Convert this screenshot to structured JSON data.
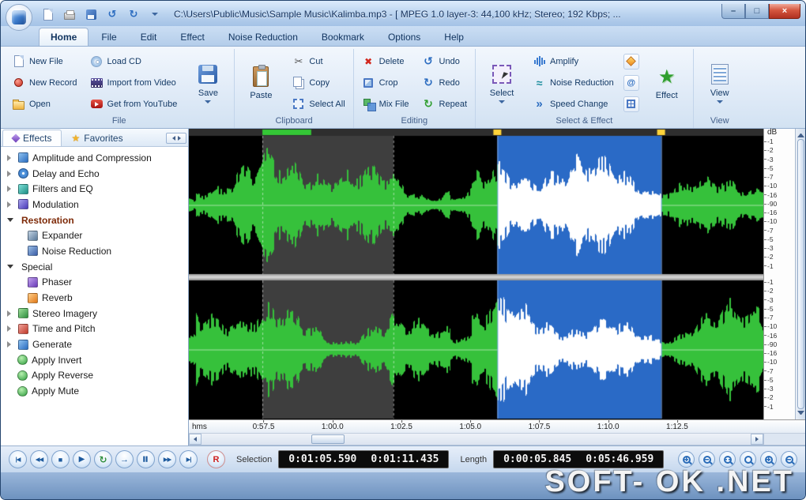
{
  "window": {
    "title": "C:\\Users\\Public\\Music\\Sample Music\\Kalimba.mp3 - [ MPEG 1.0 layer-3: 44,100 kHz; Stereo; 192 Kbps; ...",
    "controls": {
      "minimize": "–",
      "maximize": "□",
      "close": "×"
    }
  },
  "tabs": {
    "items": [
      "Home",
      "File",
      "Edit",
      "Effect",
      "Noise Reduction",
      "Bookmark",
      "Options",
      "Help"
    ],
    "active": "Home"
  },
  "ribbon": {
    "file": {
      "label": "File",
      "new_file": "New File",
      "new_record": "New Record",
      "open": "Open",
      "load_cd": "Load CD",
      "import_video": "Import from Video",
      "get_youtube": "Get from YouTube",
      "save": "Save"
    },
    "clipboard": {
      "label": "Clipboard",
      "paste": "Paste",
      "cut": "Cut",
      "copy": "Copy",
      "select_all": "Select All"
    },
    "editing": {
      "label": "Editing",
      "delete": "Delete",
      "crop": "Crop",
      "mix_file": "Mix File",
      "undo": "Undo",
      "redo": "Redo",
      "repeat": "Repeat"
    },
    "select_effect": {
      "label": "Select & Effect",
      "select": "Select",
      "amplify": "Amplify",
      "noise_reduction": "Noise Reduction",
      "speed_change": "Speed Change",
      "effect": "Effect"
    },
    "view": {
      "label": "View",
      "view": "View"
    }
  },
  "sidebar": {
    "tabs": {
      "effects": "Effects",
      "favorites": "Favorites"
    },
    "tree": [
      {
        "label": "Amplitude and Compression"
      },
      {
        "label": "Delay and Echo"
      },
      {
        "label": "Filters and EQ"
      },
      {
        "label": "Modulation"
      },
      {
        "label": "Restoration"
      },
      {
        "label": "Expander"
      },
      {
        "label": "Noise Reduction"
      },
      {
        "label": "Special"
      },
      {
        "label": "Phaser"
      },
      {
        "label": "Reverb"
      },
      {
        "label": "Stereo Imagery"
      },
      {
        "label": "Time and Pitch"
      },
      {
        "label": "Generate"
      },
      {
        "label": "Apply Invert"
      },
      {
        "label": "Apply Reverse"
      },
      {
        "label": "Apply Mute"
      }
    ]
  },
  "timeline": {
    "unit": "hms",
    "ticks": [
      {
        "label": "0:57.5",
        "pos": 13
      },
      {
        "label": "1:00.0",
        "pos": 25
      },
      {
        "label": "1:02.5",
        "pos": 37
      },
      {
        "label": "1:05.0",
        "pos": 49
      },
      {
        "label": "1:07.5",
        "pos": 61
      },
      {
        "label": "1:10.0",
        "pos": 73
      },
      {
        "label": "1:12.5",
        "pos": 85
      }
    ]
  },
  "waveform": {
    "db_label": "dB",
    "db_values": [
      "-1",
      "-2",
      "-3",
      "-5",
      "-7",
      "-10",
      "-16",
      "-90",
      "-16",
      "-10",
      "-7",
      "-5",
      "-3",
      "-2",
      "-1"
    ],
    "colors": {
      "bg": "#000000",
      "wave": "#36c13b",
      "selection_bg": "#2a6ac6",
      "selection_wave": "#ffffff",
      "dim_bg": "#3e3e3e",
      "marker": "#34c736",
      "handle": "#ffd43a"
    },
    "dim_start": 0.128,
    "dim_end": 0.356,
    "sel_start": 0.537,
    "sel_end": 0.822
  },
  "transport": {
    "buttons": [
      {
        "name": "skip-start",
        "glyph": "|◀"
      },
      {
        "name": "rewind",
        "glyph": "◀◀"
      },
      {
        "name": "stop",
        "glyph": "■"
      },
      {
        "name": "play",
        "glyph": "▶"
      },
      {
        "name": "loop",
        "glyph": "↻"
      },
      {
        "name": "forward",
        "glyph": "→"
      },
      {
        "name": "pause",
        "glyph": "▌▌"
      },
      {
        "name": "fast-forward",
        "glyph": "▶▶"
      },
      {
        "name": "skip-end",
        "glyph": "▶|"
      },
      {
        "name": "record",
        "glyph": "R"
      }
    ],
    "selection_label": "Selection",
    "selection_start": "0:01:05.590",
    "selection_end": "0:01:11.435",
    "length_label": "Length",
    "length_current": "0:00:05.845",
    "length_total": "0:05:46.959"
  },
  "glyphs": {
    "cut": "✂",
    "delete": "✖",
    "undo": "↺",
    "redo": "↻",
    "repeat": "↻",
    "noise": "≈",
    "speed": "»",
    "star": "★",
    "at": "@"
  },
  "watermark": "SOFT- OK .NET"
}
